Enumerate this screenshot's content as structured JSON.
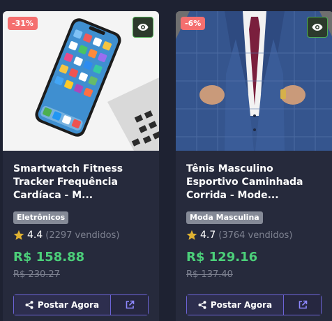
{
  "products": [
    {
      "discount": "-31%",
      "title": "Smartwatch Fitness Tracker Frequência Cardíaca - M...",
      "category": "Eletrônicos",
      "rating": "4.4",
      "sold": "(2297 vendidos)",
      "price": "R$ 158.88",
      "old_price": "R$ 230.27",
      "post_label": "Postar Agora"
    },
    {
      "discount": "-6%",
      "title": "Tênis Masculino Esportivo Caminhada Corrida - Mode...",
      "category": "Moda Masculina",
      "rating": "4.7",
      "sold": "(3764 vendidos)",
      "price": "R$ 129.16",
      "old_price": "R$ 137.40",
      "post_label": "Postar Agora"
    }
  ],
  "colors": {
    "background": "#1e2232",
    "card": "#262a3c",
    "discount_badge": "#f46f6f",
    "price": "#4cd07a",
    "accent": "#6c63d6",
    "star": "#e0b232"
  },
  "icons": [
    "eye-icon",
    "star-icon",
    "share-icon",
    "external-link-icon"
  ]
}
